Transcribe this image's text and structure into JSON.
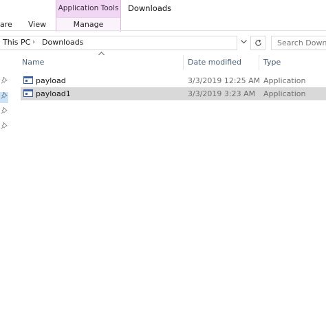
{
  "ribbon": {
    "tabs": [
      {
        "label": "are"
      },
      {
        "label": "View"
      }
    ],
    "contextual_group": "Application Tools",
    "contextual_tab": "Manage",
    "window_title": "Downloads"
  },
  "address_bar": {
    "breadcrumbs": [
      "This PC",
      "Downloads"
    ],
    "separator": "›",
    "search_placeholder": "Search Downlo"
  },
  "columns": {
    "name": "Name",
    "date_modified": "Date modified",
    "type": "Type"
  },
  "files": [
    {
      "name": "payload",
      "date_modified": "3/3/2019 12:25 AM",
      "type": "Application",
      "selected": false
    },
    {
      "name": "payload1",
      "date_modified": "3/3/2019 3:23 AM",
      "type": "Application",
      "selected": true
    }
  ],
  "icons": {
    "refresh": "refresh-icon",
    "dropdown": "chevron-down-icon",
    "pin": "pin-icon",
    "file": "application-icon",
    "sort": "sort-up-icon"
  },
  "colors": {
    "contextual_accent": "#f1d7f3",
    "selection": "#d9d9d9",
    "header_text": "#4c607a"
  }
}
